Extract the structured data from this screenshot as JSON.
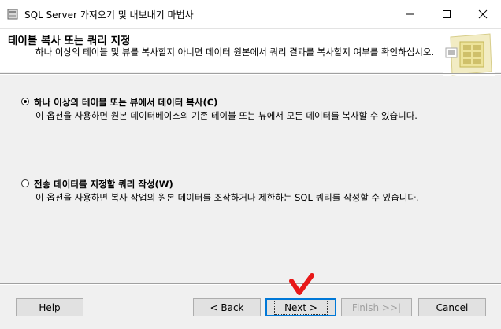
{
  "window": {
    "title": "SQL Server 가져오기 및 내보내기 마법사"
  },
  "header": {
    "title": "테이블 복사 또는 쿼리 지정",
    "subtitle": "하나 이상의 테이블 및 뷰를 복사할지 아니면 데이터 원본에서 쿼리 결과를 복사할지 여부를 확인하십시오."
  },
  "options": [
    {
      "label": "하나 이상의 테이블 또는 뷰에서 데이터 복사(C)",
      "description": "이 옵션을 사용하면 원본 데이터베이스의 기존 테이블 또는 뷰에서 모든 데이터를 복사할 수 있습니다.",
      "selected": true
    },
    {
      "label": "전송 데이터를 지정할 쿼리 작성(W)",
      "description": "이 옵션을 사용하면 복사 작업의 원본 데이터를 조작하거나 제한하는 SQL 쿼리를 작성할 수 있습니다.",
      "selected": false
    }
  ],
  "buttons": {
    "help": "Help",
    "back": "< Back",
    "next": "Next >",
    "finish": "Finish >>|",
    "cancel": "Cancel"
  },
  "annotation": {
    "mark_color": "#e81818"
  }
}
